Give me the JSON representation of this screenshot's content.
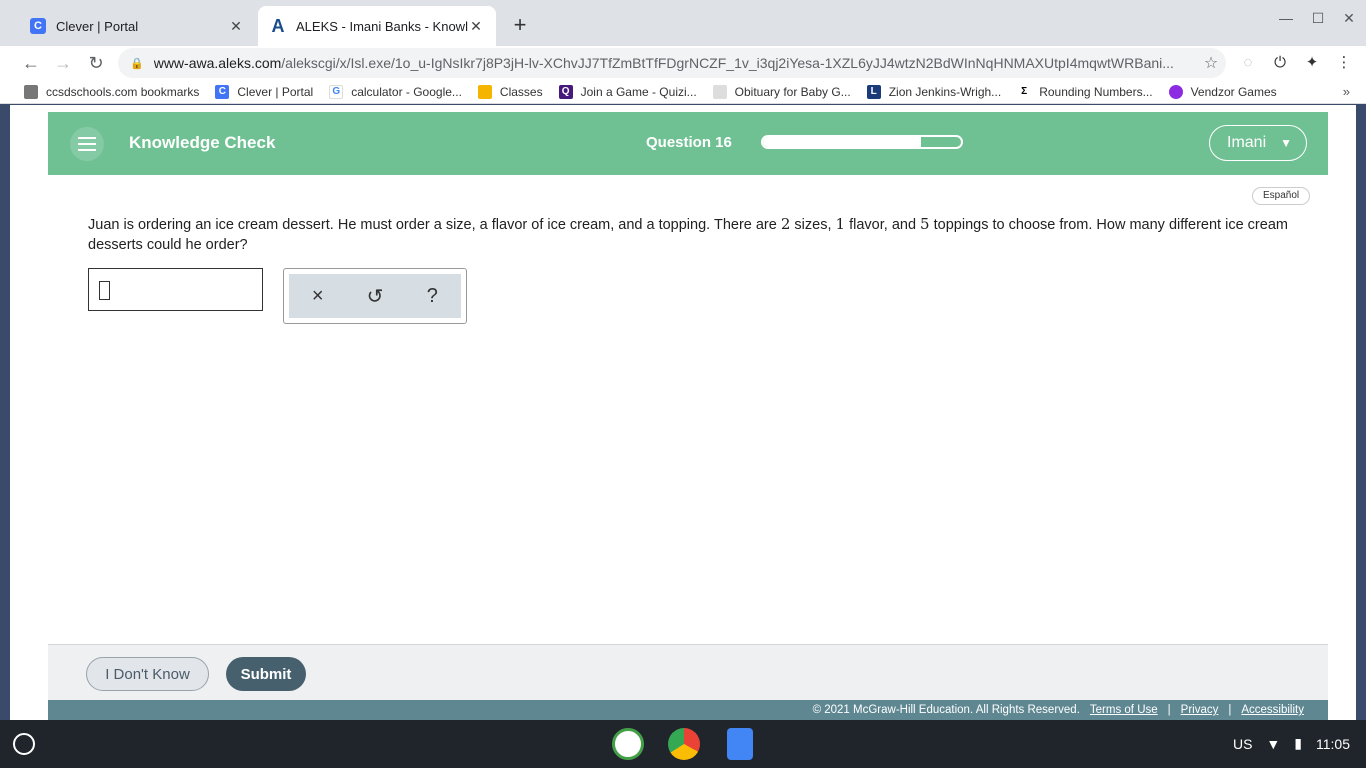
{
  "browser": {
    "tabs": [
      {
        "title": "Clever | Portal",
        "icon": "clever-icon"
      },
      {
        "title": "ALEKS - Imani Banks - Knowledg",
        "icon": "aleks-icon"
      }
    ],
    "url_host": "www-awa.aleks.com",
    "url_rest": "/alekscgi/x/Isl.exe/1o_u-IgNsIkr7j8P3jH-lv-XChvJJ7TfZmBtTfFDgrNCZF_1v_i3qj2iYesa-1XZL6yJJ4wtzN2BdWInNqHNMAXUtpI4mqwtWRBani...",
    "bookmarks": [
      "ccsdschools.com bookmarks",
      "Clever | Portal",
      "calculator - Google...",
      "Classes",
      "Join a Game - Quizi...",
      "Obituary for Baby G...",
      "Zion Jenkins-Wrigh...",
      "Rounding Numbers...",
      "Vendzor Games"
    ]
  },
  "header": {
    "title": "Knowledge Check",
    "question_label": "Question 16",
    "progress": 0.8,
    "user": "Imani"
  },
  "lang_label": "Español",
  "question": {
    "part1": "Juan is ordering an ice cream dessert. He must order a size, a flavor of ice cream, and a topping. There are ",
    "n1": "2",
    "part2": " sizes, ",
    "n2": "1",
    "part3": " flavor, and ",
    "n3": "5",
    "part4": " toppings to choose from. How many different ice cream desserts could he order?"
  },
  "tools": {
    "clear": "×",
    "undo": "↺",
    "help": "?"
  },
  "footer": {
    "dont_know": "I Don't Know",
    "submit": "Submit",
    "copyright": "© 2021 McGraw-Hill Education. All Rights Reserved.",
    "terms": "Terms of Use",
    "privacy": "Privacy",
    "accessibility": "Accessibility"
  },
  "shelf": {
    "locale": "US",
    "time": "11:05"
  }
}
